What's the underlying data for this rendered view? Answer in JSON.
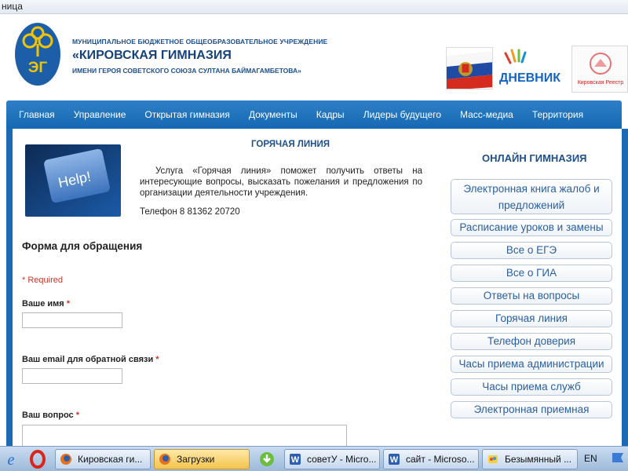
{
  "window": {
    "title": "ница"
  },
  "header": {
    "org_type": "МУНИЦИПАЛЬНОЕ БЮДЖЕТНОЕ ОБЩЕОБРАЗОВАТЕЛЬНОЕ УЧРЕЖДЕНИЕ",
    "org_name": "«КИРОВСКАЯ ГИМНАЗИЯ",
    "org_sub": "ИМЕНИ ГЕРОЯ СОВЕТСКОГО СОЮЗА СУЛТАНА БАЙМАГАМБЕТОВА»",
    "logo_text": "ЭГ",
    "diary_logo": "ДНЕВНИК",
    "registry_logo": "Кировская Реестр"
  },
  "nav": {
    "items": [
      "Главная",
      "Управление",
      "Открытая гимназия",
      "Документы",
      "Кадры",
      "Лидеры будущего",
      "Масс-медиа",
      "Территория"
    ]
  },
  "hotline": {
    "image_text": "Help!",
    "title": "ГОРЯЧАЯ ЛИНИЯ",
    "text": "Услуга «Горячая линия» поможет получить ответы на интересующие вопросы, высказать пожелания и предложения по организации деятельности учреждения.",
    "phone": "Телефон 8 81362 20720"
  },
  "form": {
    "title": "Форма для обращения",
    "required_note": "* Required",
    "fields": [
      {
        "label": "Ваше имя",
        "value": ""
      },
      {
        "label": "Ваш email для обратной связи",
        "value": ""
      },
      {
        "label": "Ваш вопрос",
        "value": ""
      }
    ],
    "star": "*"
  },
  "sidebar": {
    "title": "ОНЛАЙН ГИМНАЗИЯ",
    "items": [
      "Электронная книга жалоб и предложений",
      "Расписание уроков и замены",
      "Все о ЕГЭ",
      "Все о ГИА",
      "Ответы на вопросы",
      "Горячая линия",
      "Телефон доверия",
      "Часы приема администрации",
      "Часы приема служб",
      "Электронная приемная"
    ]
  },
  "taskbar": {
    "tasks": [
      "Кировская ги...",
      "Загрузки",
      "советУ - Micro...",
      "сайт - Microso...",
      "Безымянный ..."
    ],
    "language": "EN"
  },
  "colors": {
    "brand_blue": "#1568b2",
    "link_blue": "#2a5fa0",
    "required_red": "#c0392b",
    "active_task": "#f3c34c"
  }
}
